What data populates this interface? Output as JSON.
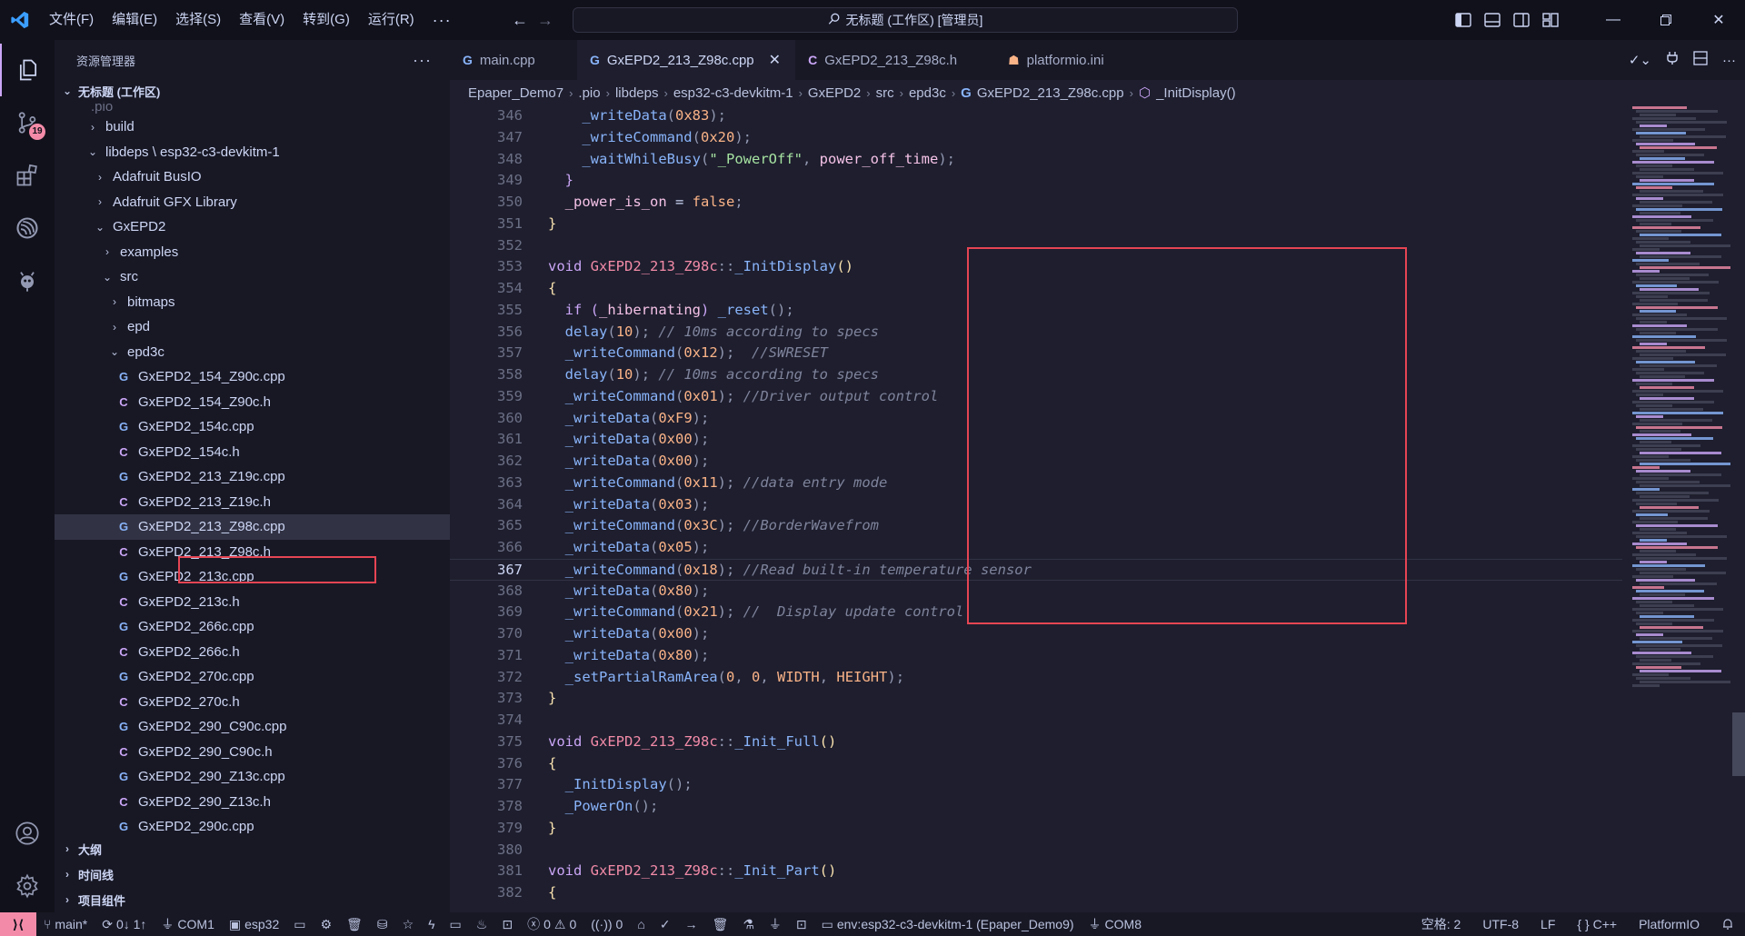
{
  "titlebar": {
    "menus": [
      "文件(F)",
      "编辑(E)",
      "选择(S)",
      "查看(V)",
      "转到(G)",
      "运行(R)"
    ],
    "more": "···",
    "command_center": "无标题 (工作区) [管理员]"
  },
  "activity": {
    "scm_badge": "19"
  },
  "sidebar": {
    "title": "资源管理器",
    "more": "···",
    "workspace": "无标题 (工作区)",
    "items": [
      {
        "label": ".pio",
        "indent": 0
      },
      {
        "label": "build",
        "indent": 1
      },
      {
        "label": "libdeps \\ esp32-c3-devkitm-1",
        "indent": 1
      },
      {
        "label": "Adafruit BusIO",
        "indent": 2
      },
      {
        "label": "Adafruit GFX Library",
        "indent": 2
      },
      {
        "label": "GxEPD2",
        "indent": 2
      },
      {
        "label": "examples",
        "indent": 3
      },
      {
        "label": "src",
        "indent": 3
      },
      {
        "label": "bitmaps",
        "indent": 4
      },
      {
        "label": "epd",
        "indent": 4
      },
      {
        "label": "epd3c",
        "indent": 4
      },
      {
        "label": "GxEPD2_154_Z90c.cpp",
        "type": "cpp"
      },
      {
        "label": "GxEPD2_154_Z90c.h",
        "type": "h"
      },
      {
        "label": "GxEPD2_154c.cpp",
        "type": "cpp"
      },
      {
        "label": "GxEPD2_154c.h",
        "type": "h"
      },
      {
        "label": "GxEPD2_213_Z19c.cpp",
        "type": "cpp"
      },
      {
        "label": "GxEPD2_213_Z19c.h",
        "type": "h"
      },
      {
        "label": "GxEPD2_213_Z98c.cpp",
        "type": "cpp",
        "selected": true
      },
      {
        "label": "GxEPD2_213_Z98c.h",
        "type": "h"
      },
      {
        "label": "GxEPD2_213c.cpp",
        "type": "cpp"
      },
      {
        "label": "GxEPD2_213c.h",
        "type": "h"
      },
      {
        "label": "GxEPD2_266c.cpp",
        "type": "cpp"
      },
      {
        "label": "GxEPD2_266c.h",
        "type": "h"
      },
      {
        "label": "GxEPD2_270c.cpp",
        "type": "cpp"
      },
      {
        "label": "GxEPD2_270c.h",
        "type": "h"
      },
      {
        "label": "GxEPD2_290_C90c.cpp",
        "type": "cpp"
      },
      {
        "label": "GxEPD2_290_C90c.h",
        "type": "h"
      },
      {
        "label": "GxEPD2_290_Z13c.cpp",
        "type": "cpp"
      },
      {
        "label": "GxEPD2_290_Z13c.h",
        "type": "h"
      },
      {
        "label": "GxEPD2_290c.cpp",
        "type": "cpp"
      }
    ],
    "panels": [
      "大纲",
      "时间线",
      "项目组件"
    ]
  },
  "tabs": [
    {
      "label": "main.cpp",
      "icon": "G",
      "type": "cpp"
    },
    {
      "label": "GxEPD2_213_Z98c.cpp",
      "icon": "G",
      "type": "cpp",
      "active": true
    },
    {
      "label": "GxEPD2_213_Z98c.h",
      "icon": "C",
      "type": "h"
    },
    {
      "label": "platformio.ini",
      "icon": "☗",
      "type": "pio"
    }
  ],
  "breadcrumb": [
    "Epaper_Demo7",
    ".pio",
    "libdeps",
    "esp32-c3-devkitm-1",
    "GxEPD2",
    "src",
    "epd3c",
    "GxEPD2_213_Z98c.cpp",
    "_InitDisplay()"
  ],
  "code": {
    "current_line": 367,
    "lines": [
      {
        "n": 346,
        "t": [
          [
            "    ",
            ""
          ],
          [
            "_writeData",
            "fn"
          ],
          [
            "(",
            "punc"
          ],
          [
            "0x83",
            "num"
          ],
          [
            ");",
            "punc"
          ]
        ]
      },
      {
        "n": 347,
        "t": [
          [
            "    ",
            ""
          ],
          [
            "_writeCommand",
            "fn"
          ],
          [
            "(",
            "punc"
          ],
          [
            "0x20",
            "num"
          ],
          [
            ");",
            "punc"
          ]
        ]
      },
      {
        "n": 348,
        "t": [
          [
            "    ",
            ""
          ],
          [
            "_waitWhileBusy",
            "fn"
          ],
          [
            "(",
            "punc"
          ],
          [
            "\"_PowerOff\"",
            "str"
          ],
          [
            ", ",
            "punc"
          ],
          [
            "power_off_time",
            "var"
          ],
          [
            ");",
            "punc"
          ]
        ]
      },
      {
        "n": 349,
        "t": [
          [
            "  ",
            ""
          ],
          [
            "}",
            "kw"
          ]
        ]
      },
      {
        "n": 350,
        "t": [
          [
            "  ",
            ""
          ],
          [
            "_power_is_on",
            "var"
          ],
          [
            " = ",
            "id"
          ],
          [
            "false",
            "num"
          ],
          [
            ";",
            "punc"
          ]
        ]
      },
      {
        "n": 351,
        "t": [
          [
            "}",
            "mac"
          ]
        ]
      },
      {
        "n": 352,
        "t": []
      },
      {
        "n": 353,
        "t": [
          [
            "void ",
            "kw"
          ],
          [
            "GxEPD2_213_Z98c",
            "cls"
          ],
          [
            "::",
            "punc"
          ],
          [
            "_InitDisplay",
            "fn"
          ],
          [
            "()",
            "mac"
          ]
        ]
      },
      {
        "n": 354,
        "t": [
          [
            "{",
            "mac"
          ]
        ]
      },
      {
        "n": 355,
        "t": [
          [
            "  ",
            ""
          ],
          [
            "if ",
            "kw"
          ],
          [
            "(",
            "kw"
          ],
          [
            "_hibernating",
            "var"
          ],
          [
            ") ",
            "kw"
          ],
          [
            "_reset",
            "fn"
          ],
          [
            "();",
            "punc"
          ]
        ]
      },
      {
        "n": 356,
        "t": [
          [
            "  ",
            ""
          ],
          [
            "delay",
            "fn"
          ],
          [
            "(",
            "punc"
          ],
          [
            "10",
            "num"
          ],
          [
            "); ",
            "punc"
          ],
          [
            "// 10ms according to specs",
            "cmt"
          ]
        ]
      },
      {
        "n": 357,
        "t": [
          [
            "  ",
            ""
          ],
          [
            "_writeCommand",
            "fn"
          ],
          [
            "(",
            "punc"
          ],
          [
            "0x12",
            "num"
          ],
          [
            ");  ",
            "punc"
          ],
          [
            "//SWRESET",
            "cmt"
          ]
        ]
      },
      {
        "n": 358,
        "t": [
          [
            "  ",
            ""
          ],
          [
            "delay",
            "fn"
          ],
          [
            "(",
            "punc"
          ],
          [
            "10",
            "num"
          ],
          [
            "); ",
            "punc"
          ],
          [
            "// 10ms according to specs",
            "cmt"
          ]
        ]
      },
      {
        "n": 359,
        "t": [
          [
            "  ",
            ""
          ],
          [
            "_writeCommand",
            "fn"
          ],
          [
            "(",
            "punc"
          ],
          [
            "0x01",
            "num"
          ],
          [
            "); ",
            "punc"
          ],
          [
            "//Driver output control",
            "cmt"
          ]
        ]
      },
      {
        "n": 360,
        "t": [
          [
            "  ",
            ""
          ],
          [
            "_writeData",
            "fn"
          ],
          [
            "(",
            "punc"
          ],
          [
            "0xF9",
            "num"
          ],
          [
            ");",
            "punc"
          ]
        ]
      },
      {
        "n": 361,
        "t": [
          [
            "  ",
            ""
          ],
          [
            "_writeData",
            "fn"
          ],
          [
            "(",
            "punc"
          ],
          [
            "0x00",
            "num"
          ],
          [
            ");",
            "punc"
          ]
        ]
      },
      {
        "n": 362,
        "t": [
          [
            "  ",
            ""
          ],
          [
            "_writeData",
            "fn"
          ],
          [
            "(",
            "punc"
          ],
          [
            "0x00",
            "num"
          ],
          [
            ");",
            "punc"
          ]
        ]
      },
      {
        "n": 363,
        "t": [
          [
            "  ",
            ""
          ],
          [
            "_writeCommand",
            "fn"
          ],
          [
            "(",
            "punc"
          ],
          [
            "0x11",
            "num"
          ],
          [
            "); ",
            "punc"
          ],
          [
            "//data entry mode",
            "cmt"
          ]
        ]
      },
      {
        "n": 364,
        "t": [
          [
            "  ",
            ""
          ],
          [
            "_writeData",
            "fn"
          ],
          [
            "(",
            "punc"
          ],
          [
            "0x03",
            "num"
          ],
          [
            ");",
            "punc"
          ]
        ]
      },
      {
        "n": 365,
        "t": [
          [
            "  ",
            ""
          ],
          [
            "_writeCommand",
            "fn"
          ],
          [
            "(",
            "punc"
          ],
          [
            "0x3C",
            "num"
          ],
          [
            "); ",
            "punc"
          ],
          [
            "//BorderWavefrom",
            "cmt"
          ]
        ]
      },
      {
        "n": 366,
        "t": [
          [
            "  ",
            ""
          ],
          [
            "_writeData",
            "fn"
          ],
          [
            "(",
            "punc"
          ],
          [
            "0x05",
            "num"
          ],
          [
            ");",
            "punc"
          ]
        ]
      },
      {
        "n": 367,
        "t": [
          [
            "  ",
            ""
          ],
          [
            "_writeCommand",
            "fn"
          ],
          [
            "(",
            "punc"
          ],
          [
            "0x18",
            "num"
          ],
          [
            "); ",
            "punc"
          ],
          [
            "//Read built-in temperature sensor",
            "cmt"
          ]
        ]
      },
      {
        "n": 368,
        "t": [
          [
            "  ",
            ""
          ],
          [
            "_writeData",
            "fn"
          ],
          [
            "(",
            "punc"
          ],
          [
            "0x80",
            "num"
          ],
          [
            ");",
            "punc"
          ]
        ]
      },
      {
        "n": 369,
        "t": [
          [
            "  ",
            ""
          ],
          [
            "_writeCommand",
            "fn"
          ],
          [
            "(",
            "punc"
          ],
          [
            "0x21",
            "num"
          ],
          [
            "); ",
            "punc"
          ],
          [
            "//  Display update control",
            "cmt"
          ]
        ]
      },
      {
        "n": 370,
        "t": [
          [
            "  ",
            ""
          ],
          [
            "_writeData",
            "fn"
          ],
          [
            "(",
            "punc"
          ],
          [
            "0x00",
            "num"
          ],
          [
            ");",
            "punc"
          ]
        ]
      },
      {
        "n": 371,
        "t": [
          [
            "  ",
            ""
          ],
          [
            "_writeData",
            "fn"
          ],
          [
            "(",
            "punc"
          ],
          [
            "0x80",
            "num"
          ],
          [
            ");",
            "punc"
          ]
        ]
      },
      {
        "n": 372,
        "t": [
          [
            "  ",
            ""
          ],
          [
            "_setPartialRamArea",
            "fn"
          ],
          [
            "(",
            "punc"
          ],
          [
            "0",
            "num"
          ],
          [
            ", ",
            "punc"
          ],
          [
            "0",
            "num"
          ],
          [
            ", ",
            "punc"
          ],
          [
            "WIDTH",
            "num"
          ],
          [
            ", ",
            "punc"
          ],
          [
            "HEIGHT",
            "num"
          ],
          [
            ");",
            "punc"
          ]
        ]
      },
      {
        "n": 373,
        "t": [
          [
            "}",
            "mac"
          ]
        ]
      },
      {
        "n": 374,
        "t": []
      },
      {
        "n": 375,
        "t": [
          [
            "void ",
            "kw"
          ],
          [
            "GxEPD2_213_Z98c",
            "cls"
          ],
          [
            "::",
            "punc"
          ],
          [
            "_Init_Full",
            "fn"
          ],
          [
            "()",
            "mac"
          ]
        ]
      },
      {
        "n": 376,
        "t": [
          [
            "{",
            "mac"
          ]
        ]
      },
      {
        "n": 377,
        "t": [
          [
            "  ",
            ""
          ],
          [
            "_InitDisplay",
            "fn"
          ],
          [
            "();",
            "punc"
          ]
        ]
      },
      {
        "n": 378,
        "t": [
          [
            "  ",
            ""
          ],
          [
            "_PowerOn",
            "fn"
          ],
          [
            "();",
            "punc"
          ]
        ]
      },
      {
        "n": 379,
        "t": [
          [
            "}",
            "mac"
          ]
        ]
      },
      {
        "n": 380,
        "t": []
      },
      {
        "n": 381,
        "t": [
          [
            "void ",
            "kw"
          ],
          [
            "GxEPD2_213_Z98c",
            "cls"
          ],
          [
            "::",
            "punc"
          ],
          [
            "_Init_Part",
            "fn"
          ],
          [
            "()",
            "mac"
          ]
        ]
      },
      {
        "n": 382,
        "t": [
          [
            "{",
            "mac"
          ]
        ]
      }
    ]
  },
  "statusbar": {
    "branch": "main*",
    "sync": "0↓ 1↑",
    "port_label": "COM1",
    "env_short": "esp32",
    "problems_errors": "0",
    "problems_warnings": "0",
    "ports_count": "0",
    "env": "env:esp32-c3-devkitm-1 (Epaper_Demo9)",
    "upload_port": "COM8",
    "indent": "空格: 2",
    "encoding": "UTF-8",
    "eol": "LF",
    "language": "C++",
    "extension": "PlatformIO"
  }
}
